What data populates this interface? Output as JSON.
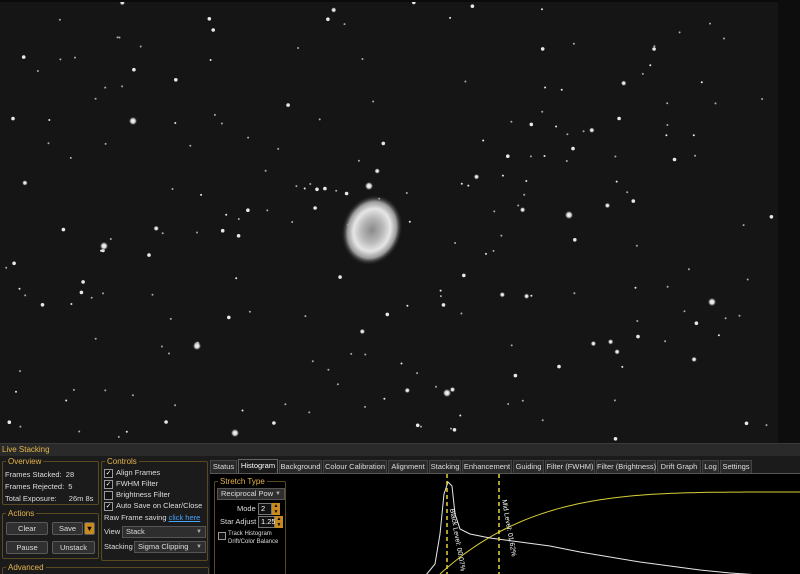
{
  "panel_title": "Live Stacking",
  "overview": {
    "title": "Overview",
    "rows": [
      {
        "label": "Frames Stacked:",
        "value": "28"
      },
      {
        "label": "Frames Rejected:",
        "value": "5"
      },
      {
        "label": "Total Exposure:",
        "value": "26m 8s"
      }
    ]
  },
  "actions": {
    "title": "Actions",
    "clear": "Clear",
    "save": "Save",
    "pause": "Pause",
    "unstack": "Unstack"
  },
  "advanced": {
    "title": "Advanced"
  },
  "controls": {
    "title": "Controls",
    "align_frames": "Align Frames",
    "fwhm_filter": "FWHM Filter",
    "brightness_filter": "Brightness Filter",
    "auto_save": "Auto Save on Clear/Close",
    "raw_frame_label": "Raw Frame saving",
    "raw_frame_link": "click here",
    "view_label": "View",
    "view_value": "Stack",
    "stacking_label": "Stacking",
    "stacking_value": "Sigma Clipping"
  },
  "tabs": [
    "Status",
    "Histogram",
    "Background",
    "Colour Calibration",
    "Alignment",
    "Stacking",
    "Enhancement",
    "Guiding",
    "Filter (FWHM)",
    "Filter (Brightness)",
    "Drift Graph",
    "Log",
    "Settings"
  ],
  "active_tab": "Histogram",
  "stretch": {
    "title": "Stretch Type",
    "type_value": "Reciprocal Pow",
    "mode_label": "Mode",
    "mode_value": "2",
    "star_adjust_label": "Star Adjust",
    "star_adjust_value": "1.25",
    "track_histogram": "Track Histogram",
    "drift_balance": "Drift/Color Balance"
  },
  "histogram": {
    "black_level_label": "Black Level: 00.07%",
    "mid_level_label": "Mid Level: 01.62%",
    "curve_color": "#d8cf3a",
    "marker_color": "#e6d23a",
    "hist_color": "#e8e8e8"
  },
  "accent_color": "#e6b64c"
}
